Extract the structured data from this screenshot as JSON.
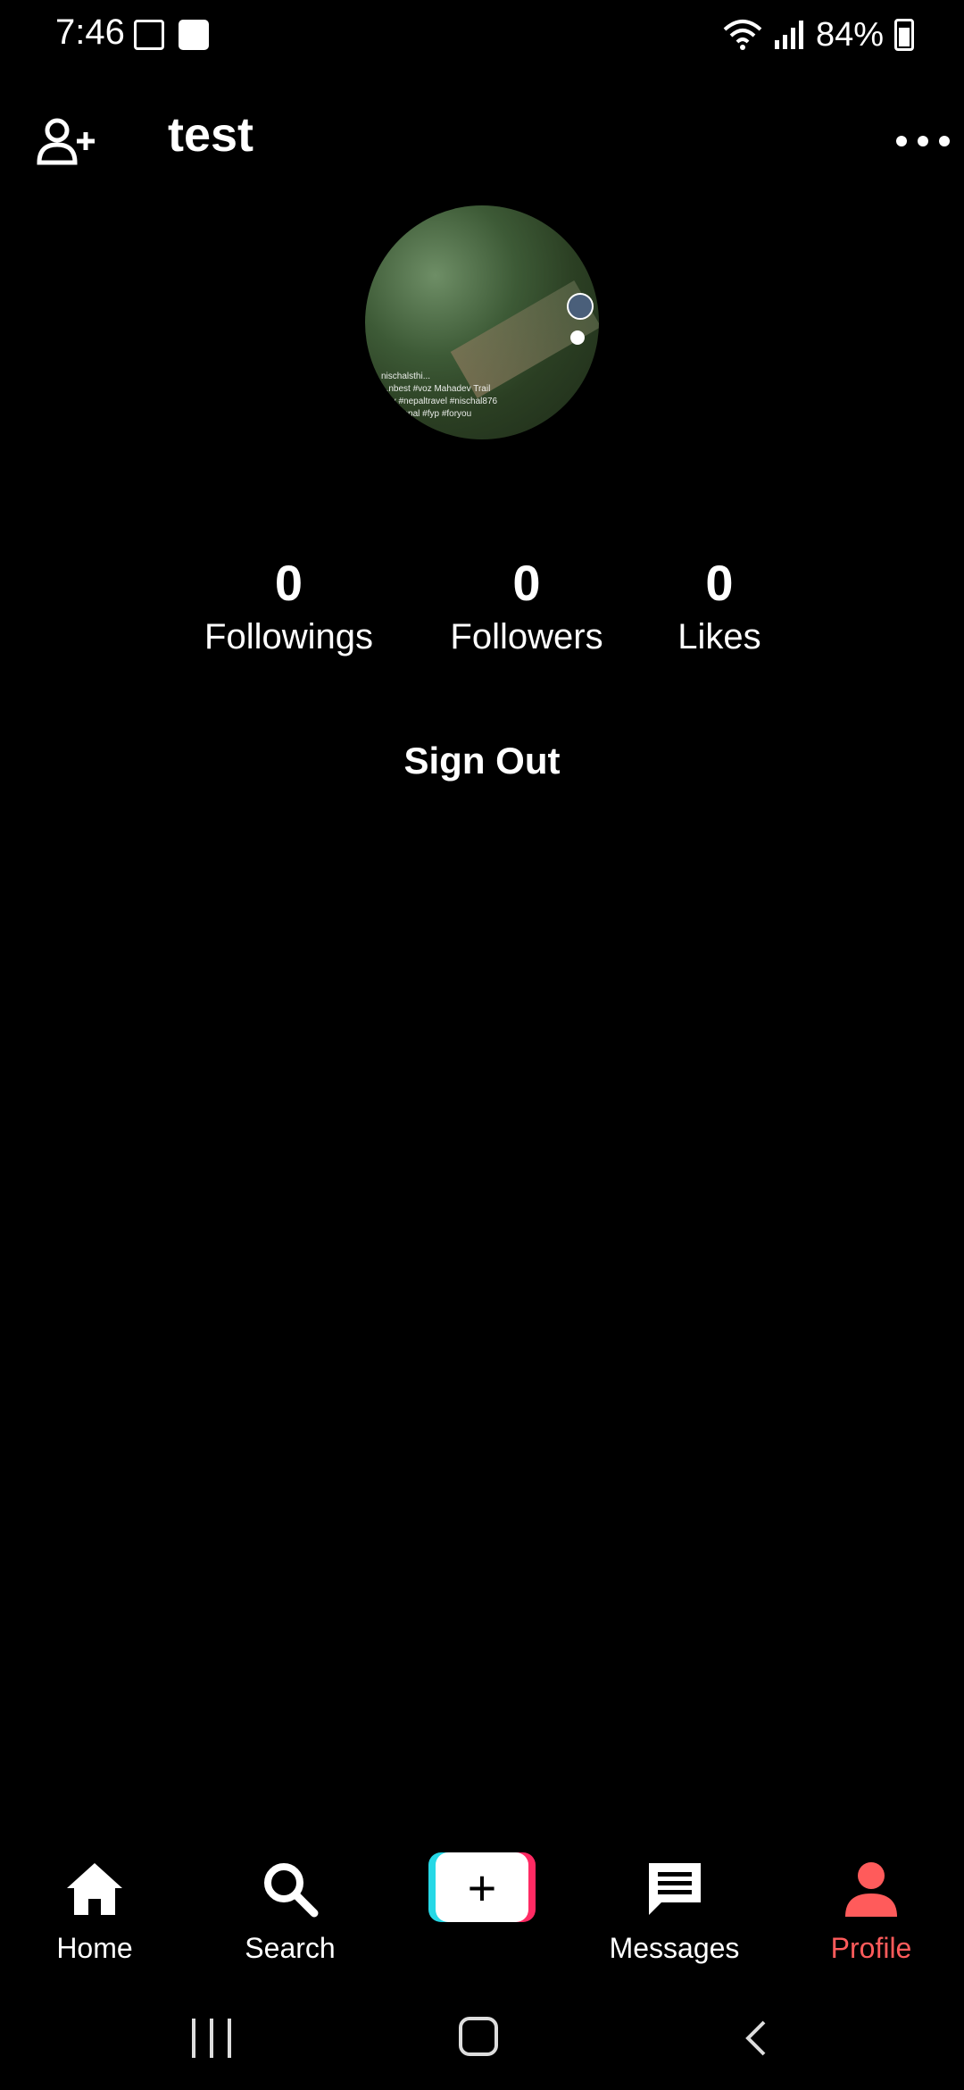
{
  "status_bar": {
    "time": "7:46",
    "battery": "84%",
    "icons": [
      "key-icon",
      "image-icon",
      "wifi-icon",
      "signal-icon",
      "battery-icon"
    ]
  },
  "header": {
    "title": "test",
    "left_icon": "add-user-icon",
    "right_icon": "more-icon"
  },
  "avatar": {
    "caption_lines": [
      "nischalsthi...",
      "...nbest #voz Mahadev Trail",
      "...ry #nepaltravel #nischal876",
      "...l #nepal #fyp #foryou"
    ]
  },
  "stats": {
    "following": {
      "count": "0",
      "label": "Followings"
    },
    "followers": {
      "count": "0",
      "label": "Followers"
    },
    "likes": {
      "count": "0",
      "label": "Likes"
    }
  },
  "actions": {
    "sign_out": "Sign Out"
  },
  "bottom_nav": {
    "items": [
      {
        "label": "Home",
        "icon": "home-icon"
      },
      {
        "label": "Search",
        "icon": "search-icon"
      },
      {
        "label": "+",
        "icon": "plus-icon"
      },
      {
        "label": "Messages",
        "icon": "message-icon"
      },
      {
        "label": "Profile",
        "icon": "profile-icon",
        "active": true
      }
    ],
    "active_color": "#ff5b5b"
  },
  "colors": {
    "background": "#000000",
    "text": "#ffffff",
    "add_cyan": "#26d8e6",
    "add_pink": "#ff2a63"
  }
}
